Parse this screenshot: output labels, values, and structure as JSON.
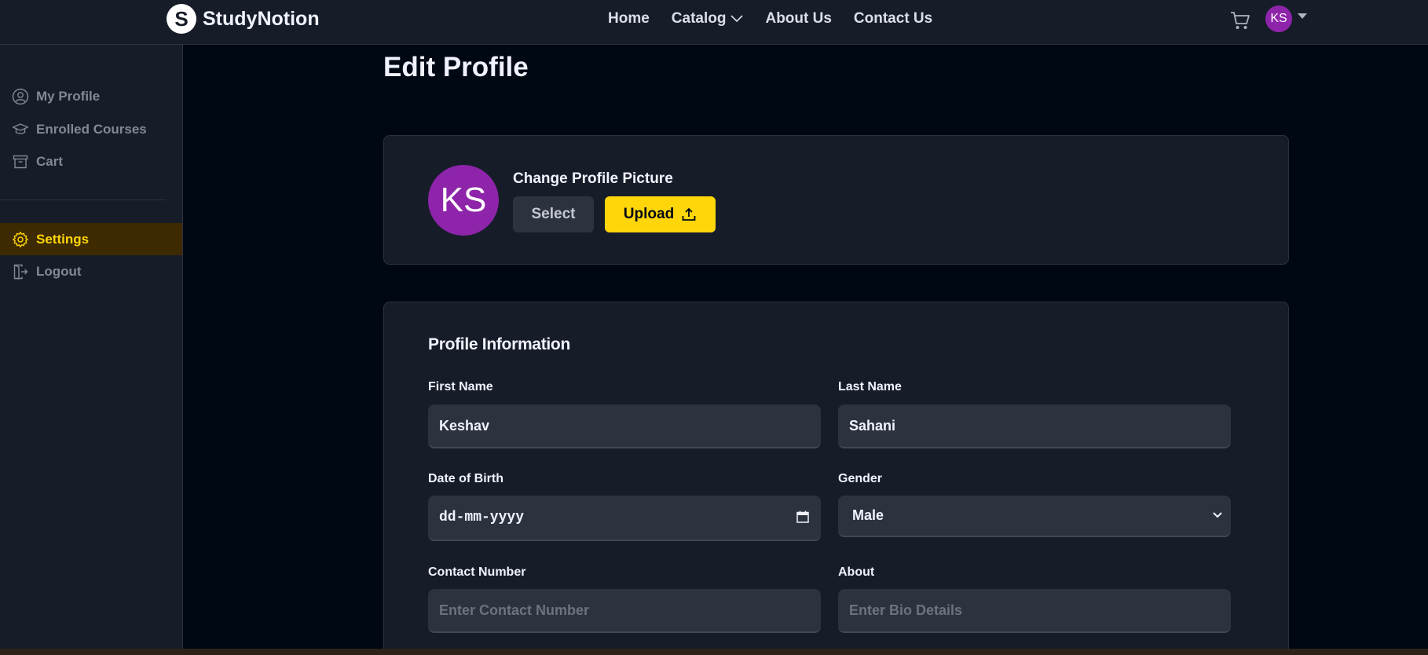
{
  "navbar": {
    "logo_mark": "S",
    "logo_text": "StudyNotion",
    "links": [
      {
        "label": "Home"
      },
      {
        "label": "Catalog"
      },
      {
        "label": "About Us"
      },
      {
        "label": "Contact Us"
      }
    ],
    "avatar_initials": "KS",
    "cart_icon": "cart-icon"
  },
  "sidebar": {
    "items": [
      {
        "label": "My Profile",
        "icon": "user-circle-icon"
      },
      {
        "label": "Enrolled Courses",
        "icon": "graduation-cap-icon"
      },
      {
        "label": "Cart",
        "icon": "archive-icon"
      }
    ],
    "settings_label": "Settings",
    "logout_label": "Logout"
  },
  "main": {
    "title": "Edit Profile",
    "picture": {
      "avatar_initials": "KS",
      "label": "Change Profile Picture",
      "select_label": "Select",
      "upload_label": "Upload"
    },
    "info": {
      "title": "Profile Information",
      "first_name": {
        "label": "First Name",
        "value": "Keshav"
      },
      "last_name": {
        "label": "Last Name",
        "value": "Sahani"
      },
      "dob": {
        "label": "Date of Birth",
        "value": "dd-mm-yyyy"
      },
      "gender": {
        "label": "Gender",
        "value": "Male"
      },
      "contact": {
        "label": "Contact Number",
        "placeholder": "Enter Contact Number"
      },
      "about": {
        "label": "About",
        "placeholder": "Enter Bio Details"
      }
    }
  },
  "colors": {
    "accent": "#FFD60A",
    "avatar": "#8E24AA",
    "background": "#000814",
    "surface": "#161D29"
  }
}
